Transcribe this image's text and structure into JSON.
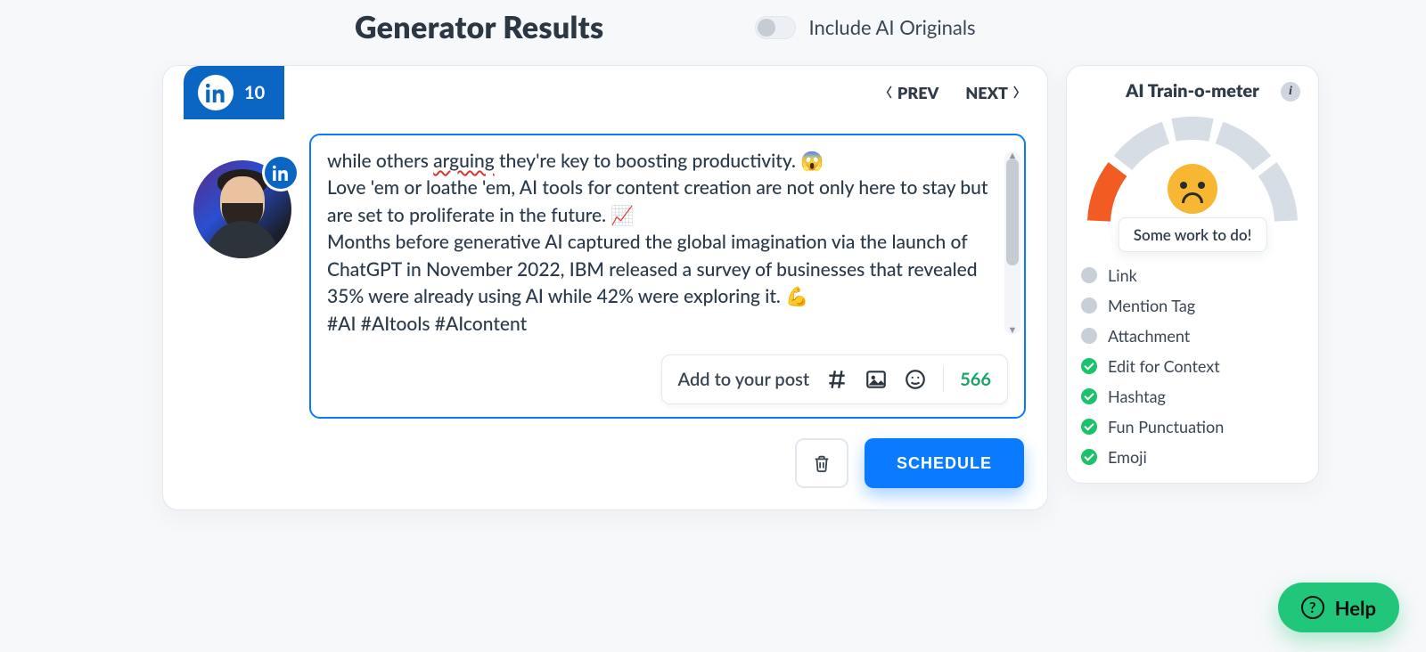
{
  "header": {
    "title": "Generator Results",
    "toggle_label": "Include AI Originals"
  },
  "tab": {
    "platform": "LinkedIn",
    "count": "10",
    "prev": "PREV",
    "next": "NEXT"
  },
  "editor": {
    "fragment_before_mispell": "while others ",
    "mispell": "arguing",
    "fragment_after_mispell": " they're key to boosting productivity. 😱",
    "para2": "Love 'em or loathe 'em, AI tools for content creation are not only here to stay but are set to proliferate in the future. 📈",
    "para3": "Months before generative AI captured the global imagination via the launch of ChatGPT in November 2022, IBM released a survey of businesses that revealed 35% were already using AI while 42% were exploring it. 💪",
    "tags": "#AI #AItools #AIcontent",
    "add_label": "Add to your post",
    "char_count": "566"
  },
  "actions": {
    "schedule": "SCHEDULE"
  },
  "meter": {
    "title": "AI Train-o-meter",
    "status": "Some work to do!",
    "fill_fraction": 0.18,
    "items": [
      {
        "label": "Link",
        "done": false
      },
      {
        "label": "Mention Tag",
        "done": false
      },
      {
        "label": "Attachment",
        "done": false
      },
      {
        "label": "Edit for Context",
        "done": true
      },
      {
        "label": "Hashtag",
        "done": true
      },
      {
        "label": "Fun Punctuation",
        "done": true
      },
      {
        "label": "Emoji",
        "done": true
      }
    ]
  },
  "help": {
    "label": "Help"
  }
}
